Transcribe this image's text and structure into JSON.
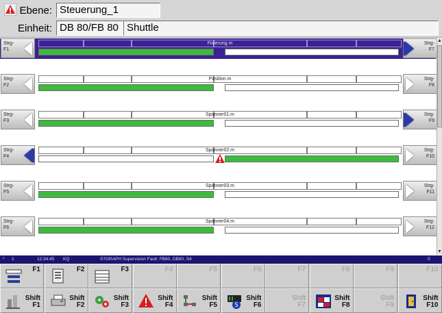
{
  "header": {
    "ebene_label": "Ebene:",
    "ebene_value": "Steuerung_1",
    "einheit_label": "Einheit:",
    "einheit_db": "DB 80/FB 80",
    "einheit_name": "Shuttle"
  },
  "rows": [
    {
      "left": "Strg-\nF1",
      "right": "Strg-\nF7",
      "name": "Fixierung.m",
      "selected": true,
      "left_bar": "on",
      "right_bar": "off",
      "fault": false
    },
    {
      "left": "Strg-\nF2",
      "right": "Strg-\nF8",
      "name": "Position.m",
      "selected": false,
      "left_bar": "on",
      "right_bar": "off",
      "fault": false
    },
    {
      "left": "Strg-\nF3",
      "right": "Strg-\nF9",
      "name": "Spanner01.m",
      "selected": false,
      "left_bar": "on",
      "right_bar": "off",
      "fault": false
    },
    {
      "left": "Strg-\nF4",
      "right": "Strg-\nF10",
      "name": "Spanner02.m",
      "selected": false,
      "left_bar": "off",
      "right_bar": "on",
      "fault": true
    },
    {
      "left": "Strg-\nF5",
      "right": "Strg-\nF11",
      "name": "Spanner03.m",
      "selected": false,
      "left_bar": "on",
      "right_bar": "off",
      "fault": false
    },
    {
      "left": "Strg-\nF6",
      "right": "Strg-\nF12",
      "name": "Spanner04.m",
      "selected": false,
      "left_bar": "on",
      "right_bar": "off",
      "fault": false
    }
  ],
  "message": {
    "marker": "*",
    "count": "1",
    "time": "12:34:45",
    "code": "KQ",
    "text": "S7GRAPH Supervision Fault: FB80, DB80, S4",
    "right": "0"
  },
  "fkeys_top": [
    {
      "label": "F1",
      "icon": "sequence-icon",
      "enabled": true
    },
    {
      "label": "F2",
      "icon": "document-icon",
      "enabled": true
    },
    {
      "label": "F3",
      "icon": "table-icon",
      "enabled": true
    },
    {
      "label": "F4",
      "icon": "",
      "enabled": false
    },
    {
      "label": "F5",
      "icon": "",
      "enabled": false
    },
    {
      "label": "F6",
      "icon": "",
      "enabled": false
    },
    {
      "label": "F7",
      "icon": "",
      "enabled": false
    },
    {
      "label": "F8",
      "icon": "",
      "enabled": false
    },
    {
      "label": "F9",
      "icon": "",
      "enabled": false
    },
    {
      "label": "F10",
      "icon": "",
      "enabled": false
    }
  ],
  "fkeys_bottom": [
    {
      "shift": "Shift",
      "label": "F1",
      "icon": "machine-icon",
      "enabled": true
    },
    {
      "shift": "Shift",
      "label": "F2",
      "icon": "printer-icon",
      "enabled": true
    },
    {
      "shift": "Shift",
      "label": "F3",
      "icon": "gears-icon",
      "enabled": true
    },
    {
      "shift": "Shift",
      "label": "F4",
      "icon": "warning-icon",
      "enabled": true
    },
    {
      "shift": "Shift",
      "label": "F5",
      "icon": "network-icon",
      "enabled": true
    },
    {
      "shift": "Shift",
      "label": "F6",
      "icon": "s7-plc-icon",
      "enabled": true
    },
    {
      "shift": "Shift",
      "label": "F7",
      "icon": "",
      "enabled": false
    },
    {
      "shift": "Shift",
      "label": "F8",
      "icon": "windows-icon",
      "enabled": true
    },
    {
      "shift": "Shift",
      "label": "F9",
      "icon": "",
      "enabled": false
    },
    {
      "shift": "Shift",
      "label": "F10",
      "icon": "exit-door-icon",
      "enabled": true
    }
  ],
  "colors": {
    "selected_row": "#3b2392",
    "active_bar": "#3dbb3d",
    "message_bar": "#1a1570",
    "fault": "#d42020"
  }
}
